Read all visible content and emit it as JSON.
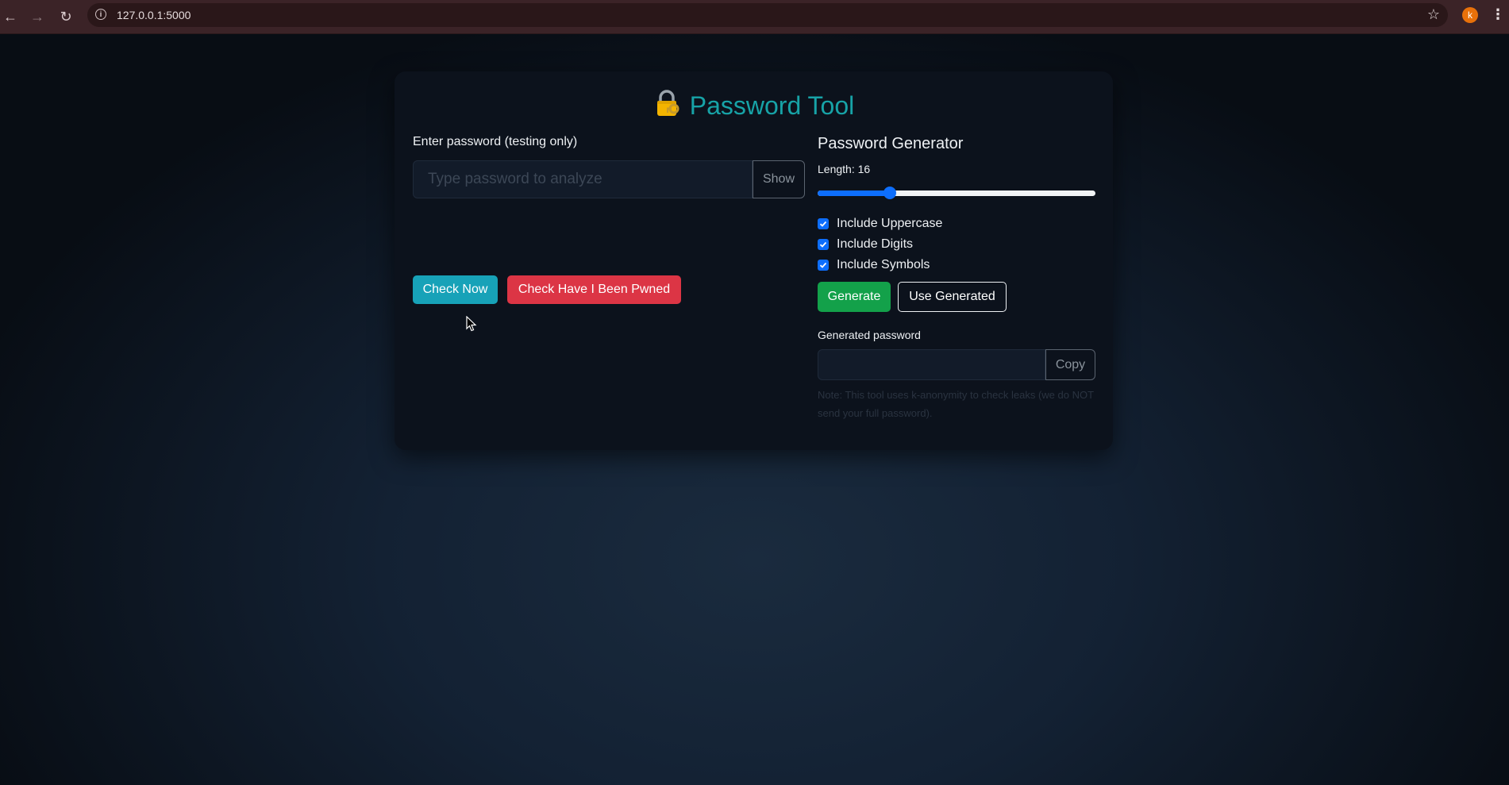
{
  "browser": {
    "url": "127.0.0.1:5000",
    "profile_initial": "k"
  },
  "app": {
    "title": "Password Tool",
    "icon": "locked-with-key-icon"
  },
  "checker": {
    "input_label": "Enter password (testing only)",
    "input_placeholder": "Type password to analyze",
    "input_value": "",
    "show_label": "Show",
    "check_now_label": "Check Now",
    "pwned_label": "Check Have I Been Pwned"
  },
  "generator": {
    "title": "Password Generator",
    "length_label": "Length: 16",
    "length_value": 16,
    "length_fraction": 0.26,
    "options": [
      {
        "label": "Include Uppercase",
        "checked": true
      },
      {
        "label": "Include Digits",
        "checked": true
      },
      {
        "label": "Include Symbols",
        "checked": true
      }
    ],
    "generate_label": "Generate",
    "use_generated_label": "Use Generated",
    "generated_label": "Generated password",
    "generated_value": "",
    "copy_label": "Copy",
    "note": "Note: This tool uses k-anonymity to check leaks (we do NOT send your full password)."
  },
  "colors": {
    "accent": "#17a3a7",
    "check_now": "#17a2b8",
    "pwned": "#dc3545",
    "generate": "#13a14a",
    "slider": "#0d6efd"
  }
}
